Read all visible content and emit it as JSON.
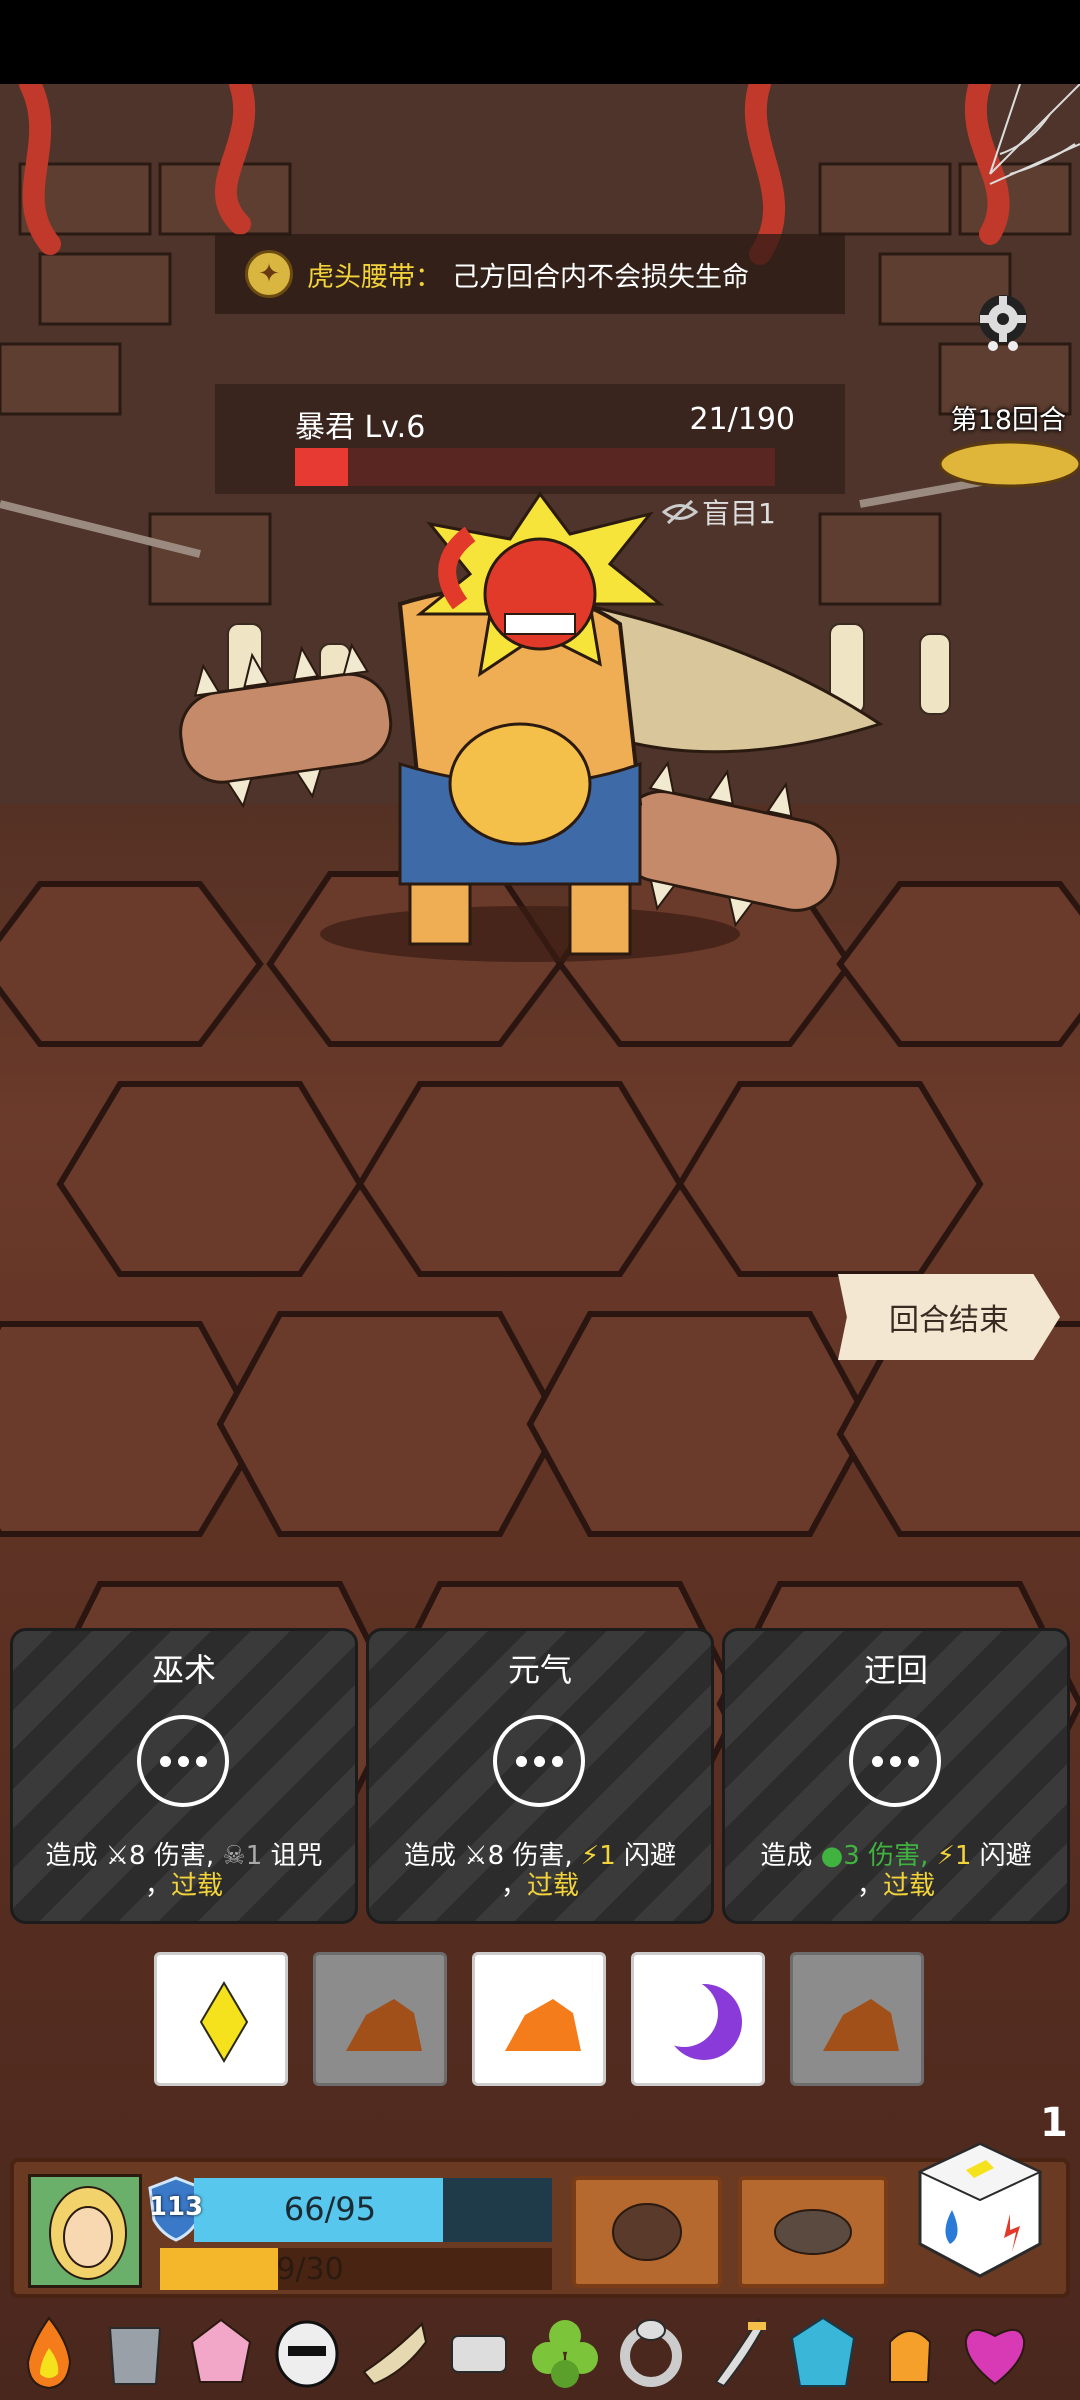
{
  "relic_banner": {
    "name": "虎头腰带：",
    "description": "己方回合内不会损失生命"
  },
  "round": {
    "label": "第18回合"
  },
  "enemy": {
    "name": "暴君  Lv.6",
    "hp_text": "21/190",
    "hp_fraction": 0.1105,
    "status": "盲目1"
  },
  "end_turn_label": "回合结束",
  "skills": [
    {
      "title": "巫术",
      "desc_prefix": "造成 ",
      "desc_main": "8 伤害,",
      "desc_extra_icon": "skull-icon",
      "desc_extra_value": "1",
      "desc_extra_label": " 诅咒",
      "desc_line2_prefix": "，",
      "desc_line2": "过载"
    },
    {
      "title": "元气",
      "desc_prefix": "造成 ",
      "desc_main": "8 伤害,",
      "desc_extra_icon": "lightning-icon",
      "desc_extra_value": "1",
      "desc_extra_label": " 闪避",
      "desc_line2_prefix": "，",
      "desc_line2": "过载"
    },
    {
      "title": "迂回",
      "desc_prefix": "造成 ",
      "desc_main": "3 伤害,",
      "desc_extra_icon": "lightning-icon",
      "desc_extra_value": "1",
      "desc_extra_label": " 闪避",
      "desc_line2_prefix": "，",
      "desc_line2": "过载"
    }
  ],
  "dice_slots": [
    {
      "icon": "yellow-diamond-icon",
      "active": true
    },
    {
      "icon": "rock-icon",
      "active": false
    },
    {
      "icon": "rock-icon",
      "active": true
    },
    {
      "icon": "purple-moon-icon",
      "active": true
    },
    {
      "icon": "rock-icon",
      "active": false
    }
  ],
  "dice_count": "1",
  "player": {
    "shield": "113",
    "hp_text": "66/95",
    "hp_fraction": 0.695,
    "energy_text": "9/30",
    "energy_fraction": 0.3
  },
  "colors": {
    "enemy_hp": "#e73a33",
    "player_hp": "#57c7ee",
    "player_energy": "#f4b62a",
    "highlight_text": "#f2d33a"
  },
  "relic_bar": [
    "fire-icon",
    "armor-icon",
    "pink-crystal-icon",
    "skull-mask-icon",
    "horn-icon",
    "scroll-icon",
    "clover-icon",
    "ring-icon",
    "dagger-icon",
    "blue-gem-icon",
    "glove-icon",
    "heart-icon"
  ]
}
